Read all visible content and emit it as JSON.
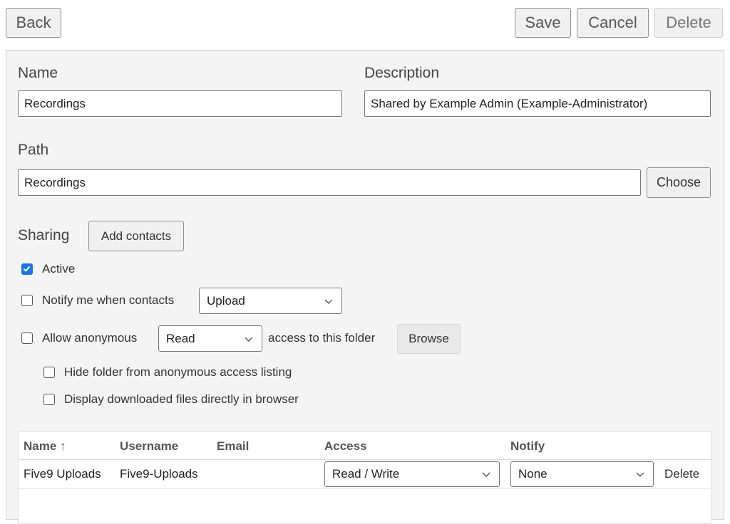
{
  "toolbar": {
    "back": "Back",
    "save": "Save",
    "cancel": "Cancel",
    "delete": "Delete"
  },
  "form": {
    "name_label": "Name",
    "name_value": "Recordings",
    "description_label": "Description",
    "description_value": "Shared by Example Admin (Example-Administrator)",
    "path_label": "Path",
    "path_value": "Recordings",
    "choose": "Choose"
  },
  "sharing": {
    "label": "Sharing",
    "add_contacts": "Add contacts",
    "active_label": "Active",
    "active_checked": true,
    "notify_label": "Notify me when contacts",
    "notify_checked": false,
    "notify_select": "Upload",
    "anon_label": "Allow anonymous",
    "anon_checked": false,
    "anon_select": "Read",
    "anon_suffix": "access to this folder",
    "browse": "Browse",
    "hide_label": "Hide folder from anonymous access listing",
    "hide_checked": false,
    "display_label": "Display downloaded files directly in browser",
    "display_checked": false
  },
  "table": {
    "headers": {
      "name": "Name ↑",
      "username": "Username",
      "email": "Email",
      "access": "Access",
      "notify": "Notify"
    },
    "rows": [
      {
        "name": "Five9 Uploads",
        "username": "Five9-Uploads",
        "email": "",
        "access": "Read / Write",
        "notify": "None",
        "delete": "Delete"
      }
    ]
  },
  "colors": {
    "accent": "#1a73e8",
    "panel_bg": "#f4f4f4"
  },
  "icons": {
    "dropdown": "chevron-down-icon",
    "checkbox": "checkbox-icon"
  }
}
